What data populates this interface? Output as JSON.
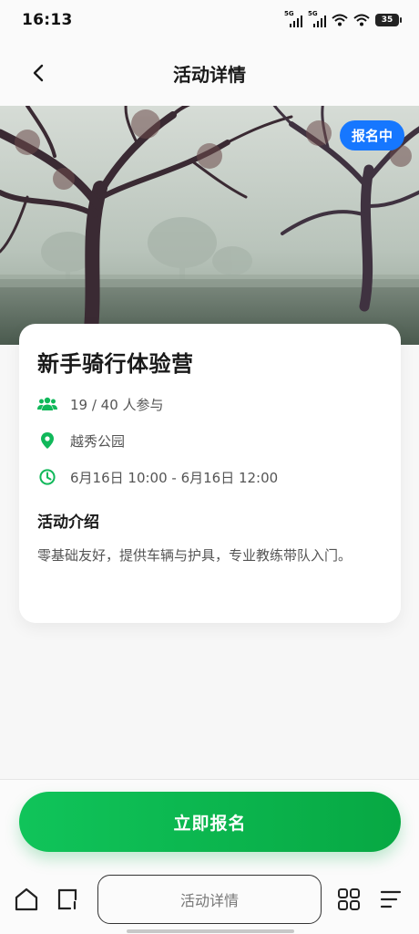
{
  "status_bar": {
    "time": "16:13",
    "network_1": "5G",
    "network_2": "5G",
    "battery": "35"
  },
  "header": {
    "title": "活动详情"
  },
  "event": {
    "badge": "报名中",
    "title": "新手骑行体验营",
    "participants": "19 / 40 人参与",
    "location": "越秀公园",
    "time": "6月16日 10:00 - 6月16日 12:00",
    "intro_heading": "活动介绍",
    "intro_text": "零基础友好，提供车辆与护具，专业教练带队入门。"
  },
  "actions": {
    "register_label": "立即报名"
  },
  "browser": {
    "tab_title": "活动详情"
  },
  "colors": {
    "accent_green": "#10c45a",
    "badge_blue": "#1677ff"
  },
  "icons": {
    "back": "chevron-left-icon",
    "participants": "users-icon",
    "location": "map-pin-icon",
    "time": "clock-icon",
    "home": "home-icon",
    "tabs": "tabs-icon",
    "apps": "apps-grid-icon",
    "menu": "menu-icon"
  }
}
